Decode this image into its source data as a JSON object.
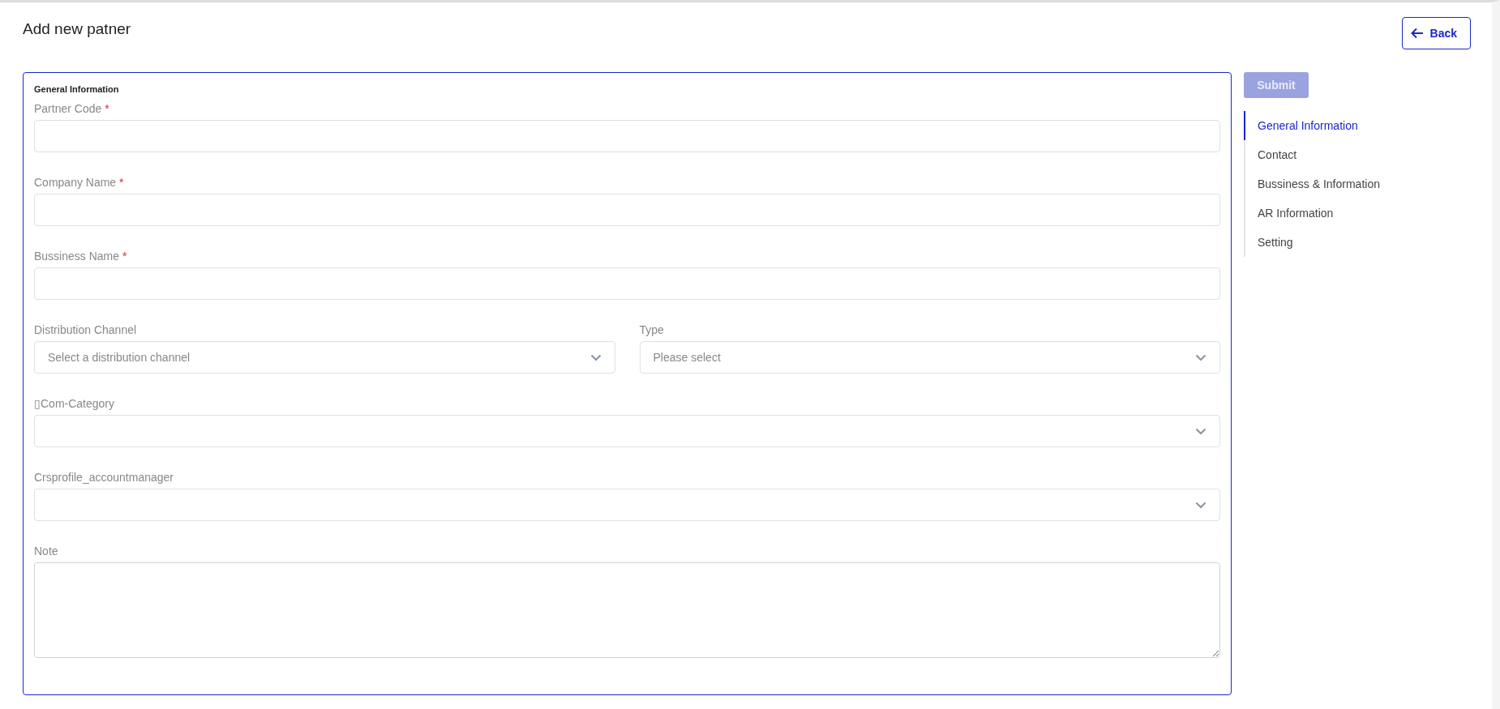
{
  "page": {
    "title": "Add new patner",
    "back_button": {
      "label": "Back"
    }
  },
  "form": {
    "section_title": "General Information",
    "rows": [
      {
        "fields": [
          {
            "kind": "text",
            "label": "Partner Code",
            "required_mark": "*"
          }
        ]
      },
      {
        "fields": [
          {
            "kind": "text",
            "label": "Company Name",
            "required_mark": "*"
          }
        ]
      },
      {
        "fields": [
          {
            "kind": "text",
            "label": "Bussiness Name",
            "required_mark": "*"
          }
        ]
      },
      {
        "fields": [
          {
            "kind": "select",
            "label": "Distribution Channel",
            "placeholder": "Select a distribution channel"
          },
          {
            "kind": "select",
            "label": "Type",
            "placeholder": "Please select"
          }
        ]
      },
      {
        "fields": [
          {
            "kind": "select",
            "label": "▯Com-Category"
          }
        ]
      },
      {
        "fields": [
          {
            "kind": "select",
            "label": "Crsprofile_accountmanager"
          }
        ]
      },
      {
        "fields": [
          {
            "kind": "textarea",
            "label": "Note"
          }
        ]
      }
    ]
  },
  "submit_button": {
    "label": "Submit",
    "disabled": true
  },
  "section_nav": [
    {
      "label": "General Information",
      "selected": true
    },
    {
      "label": "Contact",
      "selected": false
    },
    {
      "label": "Bussiness & Information",
      "selected": false
    },
    {
      "label": "AR Information",
      "selected": false
    },
    {
      "label": "Setting",
      "selected": false
    }
  ]
}
